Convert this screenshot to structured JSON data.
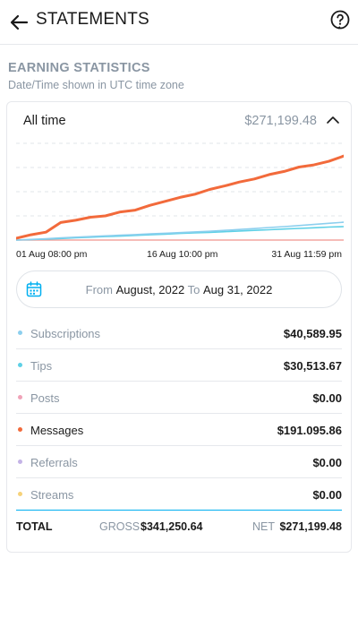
{
  "header": {
    "title": "STATEMENTS"
  },
  "section": {
    "title": "EARNING STATISTICS",
    "subtitle": "Date/Time shown in UTC time zone"
  },
  "card": {
    "period_label": "All time",
    "period_total": "$271,199.48"
  },
  "chart_data": {
    "type": "line",
    "x_tick_labels": [
      "01 Aug 08:00 pm",
      "16 Aug 10:00 pm",
      "31 Aug 11:59 pm"
    ],
    "grid": true,
    "ylim": [
      0,
      220000
    ],
    "series": [
      {
        "color": "#f26a3b",
        "values": [
          4000,
          12000,
          18000,
          40000,
          45000,
          52000,
          55000,
          64000,
          68000,
          79000,
          88000,
          97000,
          104000,
          115000,
          123000,
          132000,
          139000,
          149000,
          156000,
          166000,
          171000,
          179000,
          191000
        ]
      },
      {
        "color": "#8ccfee",
        "values": [
          0,
          1500,
          3000,
          5000,
          6500,
          8000,
          9500,
          11000,
          12500,
          14000,
          15500,
          17000,
          18500,
          20000,
          22000,
          24000,
          26000,
          28500,
          30500,
          33000,
          35500,
          38000,
          40600
        ]
      },
      {
        "color": "#5ed0e6",
        "values": [
          0,
          1000,
          2000,
          3500,
          5000,
          6500,
          8000,
          9000,
          10500,
          12000,
          13500,
          15000,
          16500,
          17500,
          19000,
          20500,
          22000,
          23500,
          25000,
          26500,
          28000,
          29500,
          30500
        ]
      },
      {
        "color": "#f4a6a0",
        "values": [
          0,
          0,
          0,
          0,
          0,
          0,
          0,
          0,
          0,
          0,
          0,
          0,
          0,
          0,
          0,
          0,
          0,
          0,
          0,
          0,
          0,
          0,
          0
        ]
      }
    ]
  },
  "date_filter": {
    "from_label": "From",
    "from_value": "August, 2022",
    "to_label": "To",
    "to_value": "Aug 31, 2022"
  },
  "breakdown": [
    {
      "label": "Subscriptions",
      "value": "$40,589.95",
      "color": "#8ccfee",
      "active": false
    },
    {
      "label": "Tips",
      "value": "$30,513.67",
      "color": "#5ed0e6",
      "active": false
    },
    {
      "label": "Posts",
      "value": "$0.00",
      "color": "#f0a3b8",
      "active": false
    },
    {
      "label": "Messages",
      "value": "$191.095.86",
      "color": "#f26a3b",
      "active": true
    },
    {
      "label": "Referrals",
      "value": "$0.00",
      "color": "#c4b3e6",
      "active": false
    },
    {
      "label": "Streams",
      "value": "$0.00",
      "color": "#f6d27a",
      "active": false
    }
  ],
  "totals": {
    "total_label": "TOTAL",
    "gross_label": "GROSS",
    "gross_value": "$341,250.64",
    "net_label": "NET",
    "net_value": "$271,199.48"
  },
  "colors": {
    "accent": "#00aff0",
    "muted": "#8a96a3"
  }
}
